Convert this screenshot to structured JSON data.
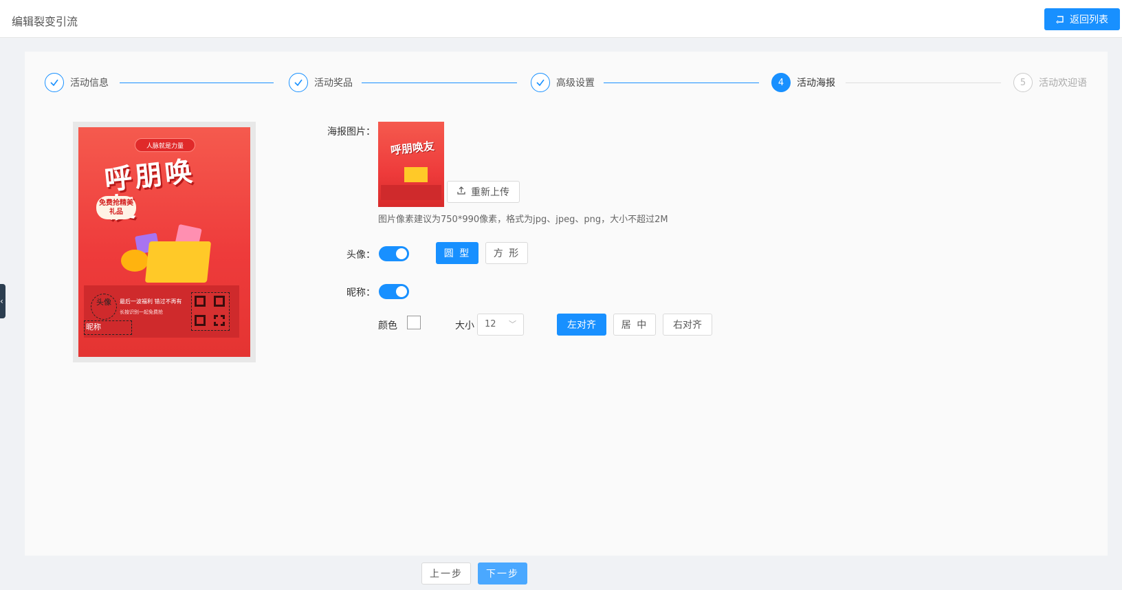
{
  "header": {
    "title": "编辑裂变引流",
    "back_label": "返回列表"
  },
  "steps": [
    {
      "label": "活动信息",
      "state": "done",
      "marker": ""
    },
    {
      "label": "活动奖品",
      "state": "done",
      "marker": ""
    },
    {
      "label": "高级设置",
      "state": "done",
      "marker": ""
    },
    {
      "label": "活动海报",
      "state": "active",
      "marker": "4"
    },
    {
      "label": "活动欢迎语",
      "state": "pending",
      "marker": "5"
    }
  ],
  "poster": {
    "tag": "人脉就是力量",
    "headline": "呼朋唤友",
    "bubble": "免费抢精美礼品",
    "avatar_text": "头像",
    "line1": "最后一波福利 错过不再有",
    "line2": "长按识别一起免费抢",
    "nickname_text": "昵称"
  },
  "form": {
    "poster_image_label": "海报图片：",
    "reupload_label": "重新上传",
    "hint": "图片像素建议为750*990像素，格式为jpg、jpeg、png，大小不超过2M",
    "avatar_label": "头像：",
    "avatar_enabled": true,
    "shape_round": "圆 型",
    "shape_square": "方 形",
    "nickname_label": "昵称：",
    "nickname_enabled": true,
    "color_label": "颜色",
    "size_label": "大小",
    "size_value": "12",
    "align_left": "左对齐",
    "align_center": "居 中",
    "align_right": "右对齐"
  },
  "footer": {
    "prev_label": "上一步",
    "next_label": "下一步"
  },
  "colors": {
    "primary": "#1890ff",
    "poster_red": "#ee3b3b"
  }
}
